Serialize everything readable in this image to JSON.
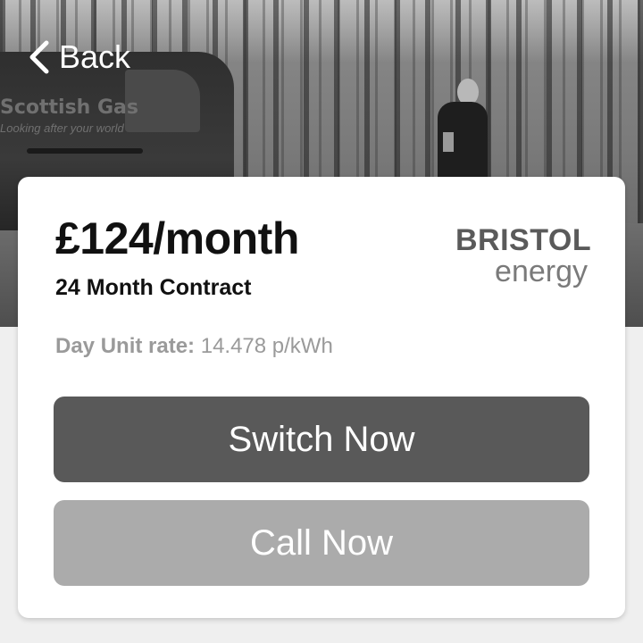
{
  "nav": {
    "back_label": "Back",
    "back_icon": "chevron-left-icon"
  },
  "hero": {
    "van_brand": "Scottish Gas",
    "van_tagline": "Looking after your world"
  },
  "tariff": {
    "price": "£124/month",
    "contract": "24 Month Contract",
    "rate_label": "Day Unit rate:",
    "rate_value": " 14.478 p/kWh"
  },
  "supplier_logo": {
    "line1": "BRISTOL",
    "line2": "energy"
  },
  "actions": {
    "switch_label": "Switch Now",
    "call_label": "Call Now"
  },
  "colors": {
    "switch_button": "#595959",
    "call_button": "#ababab",
    "card_background": "#ffffff",
    "page_background": "#efefef"
  }
}
